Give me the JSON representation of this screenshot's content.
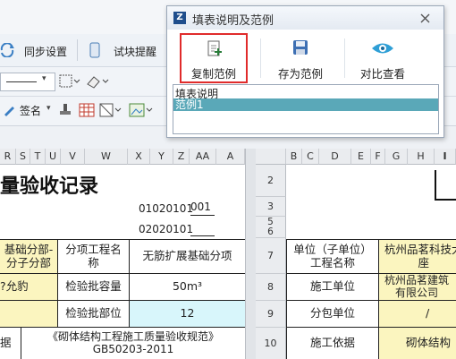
{
  "toolbar1": {
    "sync_settings": "同步设置",
    "block_hint": "试块提醒"
  },
  "toolbar3": {
    "sign": "签名"
  },
  "left_sheet": {
    "columns": [
      "R",
      "S",
      "T",
      "U",
      "V",
      "W",
      "X",
      "Y",
      "Z",
      "AA",
      "A"
    ],
    "title": "量验收记录",
    "code1_label": "01020101",
    "code1_value": "001",
    "code2_label": "02020101",
    "code2_value": "",
    "subdivision_label": "基础分部-\n分子分部",
    "sub_item_label": "分项工程名\n称",
    "sub_item_value": "无筋扩展基础分项",
    "allow_label": "?允豹",
    "batch_capacity_label": "检验批容量",
    "batch_capacity_value": "50m³",
    "batch_part_label": "检验批部位",
    "batch_part_value": "12",
    "basis_label": "据",
    "basis_value": "《砌体结构工程施工质量验收规范》\nGB50203-2011"
  },
  "right_sheet": {
    "columns": [
      "B",
      "C",
      "D",
      "E",
      "F",
      "G",
      "H",
      "I"
    ],
    "rows": [
      "2",
      "3",
      "5\n6",
      "7",
      "8",
      "9",
      "10"
    ],
    "unit_label": "单位（子单位）\n工程名称",
    "unit_value": "杭州品茗科技大\n座",
    "construction_label": "施工单位",
    "construction_value": "杭州品茗建筑\n有限公司",
    "subcontract_label": "分包单位",
    "subcontract_value": "/",
    "basis_label": "施工依据",
    "basis_value": "砌体结构"
  },
  "dialog": {
    "title": "填表说明及范例",
    "buttons": {
      "copy_example": "复制范例",
      "save_example": "存为范例",
      "compare_view": "对比查看"
    },
    "list_items": [
      "填表说明",
      "范例1"
    ],
    "selected_index": 1,
    "accent_color": "#e02b2b",
    "selection_color": "#5aa8b8"
  }
}
